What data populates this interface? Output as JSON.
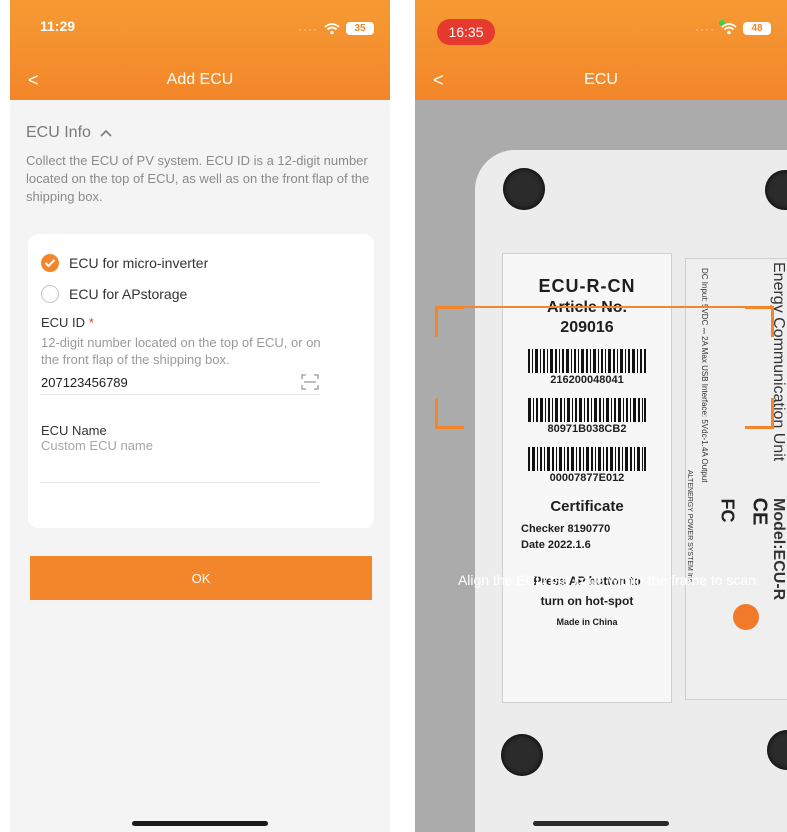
{
  "left": {
    "status": {
      "time": "11:29",
      "battery": "35"
    },
    "nav": {
      "title": "Add ECU",
      "back": "<"
    },
    "section": {
      "title": "ECU Info",
      "description": "Collect the ECU of PV system. ECU ID is a 12-digit number located on the top of ECU, as well as on the front flap of the shipping box."
    },
    "options": [
      {
        "label": "ECU for micro-inverter",
        "selected": true
      },
      {
        "label": "ECU for APstorage",
        "selected": false
      }
    ],
    "ecu_id": {
      "label": "ECU ID",
      "required": "*",
      "hint": "12-digit number located on the top of ECU, or on the front flap of the shipping box.",
      "value": "207123456789"
    },
    "ecu_name": {
      "label": "ECU Name",
      "placeholder": "Custom ECU name"
    },
    "ok_label": "OK"
  },
  "right": {
    "status": {
      "time": "16:35",
      "battery": "48"
    },
    "nav": {
      "title": "ECU",
      "back": "<"
    },
    "scan_hint": "Align the ECU bar code within the frame to scan",
    "sticker": {
      "title": "ECU-R-CN",
      "article_label": "Article No.",
      "article_no": "209016",
      "barcodes": [
        "216200048041",
        "80971B038CB2",
        "00007877E012"
      ],
      "certificate": "Certificate",
      "checker": "Checker  8190770",
      "date": "Date    2022.1.6",
      "press_line1": "Press AP button to",
      "press_line2": "turn on hot-spot",
      "made": "Made in China"
    },
    "device_text": {
      "brand": "Energy Communication Unit",
      "model": "Model:ECU-R",
      "specs": "DC Input: 5VDC ⎓ 2A Max  USB Interface: 5Vdc-1.4A Output",
      "maker": "ALTENERGY POWER SYSTEM Inc."
    },
    "colors": {
      "accent": "#f3862a"
    }
  }
}
